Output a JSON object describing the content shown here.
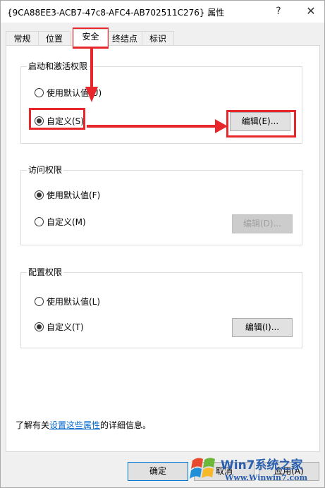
{
  "window": {
    "title": "{9CA88EE3-ACB7-47c8-AFC4-AB702511C276} 属性",
    "help_glyph": "?",
    "close_glyph": "✕"
  },
  "tabs": [
    {
      "label": "常规",
      "active": false
    },
    {
      "label": "位置",
      "active": false
    },
    {
      "label": "安全",
      "active": true
    },
    {
      "label": "终结点",
      "active": false
    },
    {
      "label": "标识",
      "active": false
    }
  ],
  "launch_group": {
    "title": "启动和激活权限",
    "options": [
      {
        "label": "使用默认值(U)",
        "checked": false
      },
      {
        "label": "自定义(S)",
        "checked": true
      }
    ],
    "edit_button": {
      "label": "编辑(E)...",
      "enabled": true
    }
  },
  "access_group": {
    "title": "访问权限",
    "options": [
      {
        "label": "使用默认值(F)",
        "checked": true
      },
      {
        "label": "自定义(M)",
        "checked": false
      }
    ],
    "edit_button": {
      "label": "编辑(D)...",
      "enabled": false
    }
  },
  "config_group": {
    "title": "配置权限",
    "options": [
      {
        "label": "使用默认值(L)",
        "checked": false
      },
      {
        "label": "自定义(T)",
        "checked": true
      }
    ],
    "edit_button": {
      "label": "编辑(I)...",
      "enabled": true
    }
  },
  "info": {
    "prefix": "了解有关",
    "link": "设置这些属性",
    "suffix": "的详细信息。"
  },
  "footer": {
    "ok": "确定",
    "cancel": "取消",
    "apply": "应用(A)"
  },
  "watermark": {
    "title": "Win7系统之家",
    "url": "Www.Winwin7.com"
  },
  "colors": {
    "annotation": "#e8272c",
    "link": "#0066cc",
    "watermark": "#2a5fb0"
  }
}
